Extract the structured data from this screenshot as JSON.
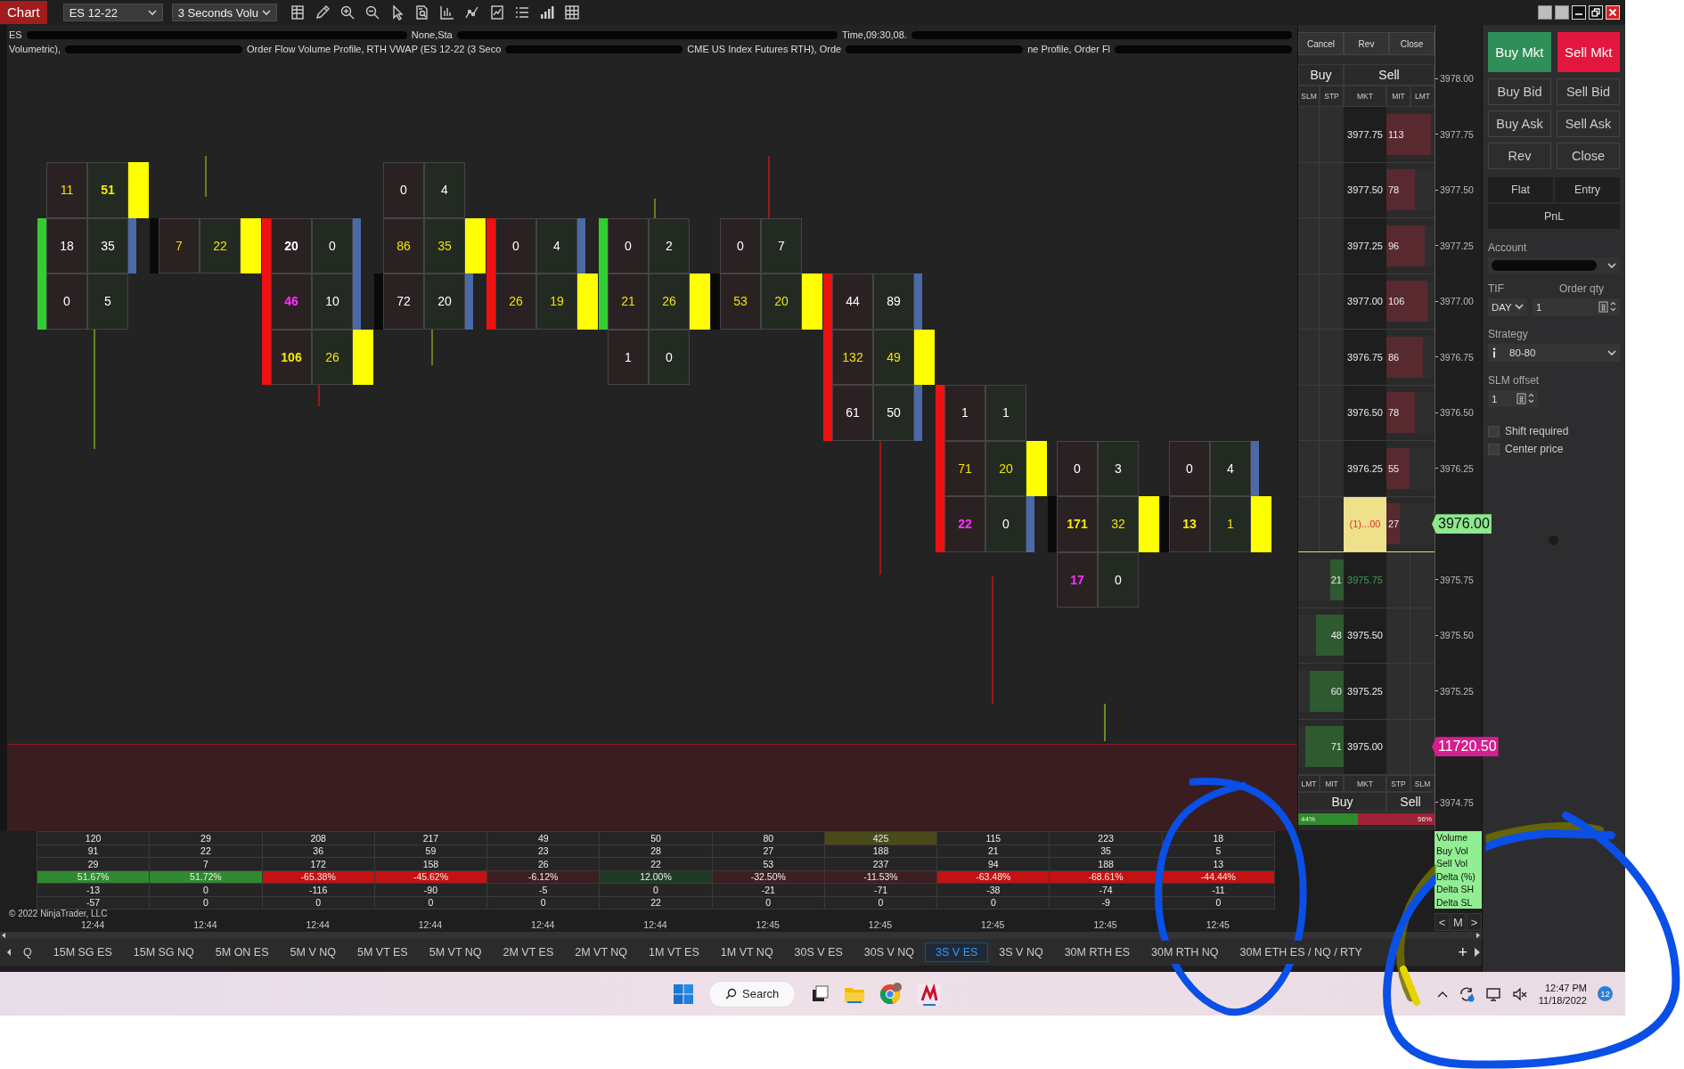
{
  "titlebar": {
    "app_label": "Chart",
    "instrument": "ES 12-22",
    "bar_type": "3 Seconds Volu"
  },
  "chart": {
    "header_lines": [
      [
        {
          "kind": "text",
          "text": "ES"
        },
        {
          "kind": "redacted"
        },
        {
          "kind": "text",
          "text": "None,Sta"
        },
        {
          "kind": "redacted"
        },
        {
          "kind": "text",
          "text": "Time,09:30,08."
        },
        {
          "kind": "redacted"
        }
      ],
      [
        {
          "kind": "text",
          "text": "Volumetric),"
        },
        {
          "kind": "redacted"
        },
        {
          "kind": "text",
          "text": "Order Flow Volume Profile, RTH VWAP (ES 12-22 (3 Seco"
        },
        {
          "kind": "redacted"
        },
        {
          "kind": "text",
          "text": "CME US Index Futures RTH), Orde"
        },
        {
          "kind": "redacted"
        },
        {
          "kind": "text",
          "text": "ne Profile, Order Fl"
        },
        {
          "kind": "redacted"
        }
      ]
    ],
    "bars": [
      {
        "levels": [
          {
            "kind": "cell",
            "bid": {
              "value": "11",
              "kind": "imbalance"
            },
            "ask": {
              "value": "51",
              "kind": "max"
            },
            "poc": true,
            "volume_marker": false
          },
          {
            "kind": "cell",
            "bid": {
              "value": "18",
              "kind": "plain"
            },
            "ask": {
              "value": "35",
              "kind": "plain"
            },
            "color": "#33cc33",
            "poc": false,
            "volume_marker": true
          },
          {
            "kind": "cell",
            "bid": {
              "value": "0",
              "kind": "plain"
            },
            "ask": {
              "value": "5",
              "kind": "plain"
            },
            "color": "#33cc33",
            "poc": false,
            "volume_marker": false
          },
          {
            "kind": "blank"
          },
          {
            "kind": "blank"
          },
          {
            "kind": "blank"
          },
          {
            "kind": "blank"
          },
          {
            "kind": "blank"
          }
        ]
      },
      {
        "levels": [
          {
            "kind": "blank"
          },
          {
            "kind": "cell",
            "bid": {
              "value": "7",
              "kind": "imbalance"
            },
            "ask": {
              "value": "22",
              "kind": "imbalance"
            },
            "color": "#0a0a0a",
            "poc": true,
            "volume_marker": false
          },
          {
            "kind": "blank"
          },
          {
            "kind": "blank"
          },
          {
            "kind": "blank"
          },
          {
            "kind": "blank"
          },
          {
            "kind": "blank"
          },
          {
            "kind": "blank"
          }
        ]
      },
      {
        "levels": [
          {
            "kind": "blank"
          },
          {
            "kind": "cell",
            "bid": {
              "value": "20",
              "kind": "bold"
            },
            "ask": {
              "value": "0",
              "kind": "plain"
            },
            "color": "#ee1111",
            "poc": false,
            "volume_marker": true
          },
          {
            "kind": "cell",
            "bid": {
              "value": "46",
              "kind": "strong"
            },
            "ask": {
              "value": "10",
              "kind": "plain"
            },
            "color": "#ee1111",
            "poc": false,
            "volume_marker": true
          },
          {
            "kind": "cell",
            "bid": {
              "value": "106",
              "kind": "max"
            },
            "ask": {
              "value": "26",
              "kind": "imbalance"
            },
            "color": "#ee1111",
            "poc": true,
            "volume_marker": false
          },
          {
            "kind": "blank"
          },
          {
            "kind": "blank"
          },
          {
            "kind": "blank"
          },
          {
            "kind": "blank"
          }
        ]
      },
      {
        "levels": [
          {
            "kind": "cell",
            "bid": {
              "value": "0",
              "kind": "plain"
            },
            "ask": {
              "value": "4",
              "kind": "plain"
            },
            "poc": false,
            "volume_marker": false
          },
          {
            "kind": "cell",
            "bid": {
              "value": "86",
              "kind": "imbalance"
            },
            "ask": {
              "value": "35",
              "kind": "imbalance"
            },
            "poc": true,
            "volume_marker": false
          },
          {
            "kind": "cell",
            "bid": {
              "value": "72",
              "kind": "plain"
            },
            "ask": {
              "value": "20",
              "kind": "plain"
            },
            "color": "#0a0a0a",
            "poc": false,
            "volume_marker": true
          },
          {
            "kind": "blank"
          },
          {
            "kind": "blank"
          },
          {
            "kind": "blank"
          },
          {
            "kind": "blank"
          },
          {
            "kind": "blank"
          }
        ]
      },
      {
        "levels": [
          {
            "kind": "blank"
          },
          {
            "kind": "cell",
            "bid": {
              "value": "0",
              "kind": "plain"
            },
            "ask": {
              "value": "4",
              "kind": "plain"
            },
            "color": "#ee1111",
            "poc": false,
            "volume_marker": true
          },
          {
            "kind": "cell",
            "bid": {
              "value": "26",
              "kind": "imbalance"
            },
            "ask": {
              "value": "19",
              "kind": "imbalance"
            },
            "color": "#ee1111",
            "poc": true,
            "volume_marker": false
          },
          {
            "kind": "blank"
          },
          {
            "kind": "blank"
          },
          {
            "kind": "blank"
          },
          {
            "kind": "blank"
          },
          {
            "kind": "blank"
          }
        ]
      },
      {
        "levels": [
          {
            "kind": "blank"
          },
          {
            "kind": "cell",
            "bid": {
              "value": "0",
              "kind": "plain"
            },
            "ask": {
              "value": "2",
              "kind": "plain"
            },
            "color": "#33cc33",
            "poc": false,
            "volume_marker": false
          },
          {
            "kind": "cell",
            "bid": {
              "value": "21",
              "kind": "imbalance"
            },
            "ask": {
              "value": "26",
              "kind": "imbalance"
            },
            "color": "#33cc33",
            "poc": true,
            "volume_marker": false
          },
          {
            "kind": "cell",
            "bid": {
              "value": "1",
              "kind": "plain"
            },
            "ask": {
              "value": "0",
              "kind": "plain"
            },
            "poc": false,
            "volume_marker": false
          },
          {
            "kind": "blank"
          },
          {
            "kind": "blank"
          },
          {
            "kind": "blank"
          },
          {
            "kind": "blank"
          }
        ]
      },
      {
        "levels": [
          {
            "kind": "blank"
          },
          {
            "kind": "cell",
            "bid": {
              "value": "0",
              "kind": "plain"
            },
            "ask": {
              "value": "7",
              "kind": "plain"
            },
            "poc": false,
            "volume_marker": false
          },
          {
            "kind": "cell",
            "bid": {
              "value": "53",
              "kind": "imbalance"
            },
            "ask": {
              "value": "20",
              "kind": "imbalance"
            },
            "color": "#0a0a0a",
            "poc": true,
            "volume_marker": false
          },
          {
            "kind": "blank"
          },
          {
            "kind": "blank"
          },
          {
            "kind": "blank"
          },
          {
            "kind": "blank"
          },
          {
            "kind": "blank"
          }
        ]
      },
      {
        "levels": [
          {
            "kind": "blank"
          },
          {
            "kind": "blank"
          },
          {
            "kind": "cell",
            "bid": {
              "value": "44",
              "kind": "plain"
            },
            "ask": {
              "value": "89",
              "kind": "plain"
            },
            "color": "#ee1111",
            "poc": false,
            "volume_marker": true
          },
          {
            "kind": "cell",
            "bid": {
              "value": "132",
              "kind": "imbalance"
            },
            "ask": {
              "value": "49",
              "kind": "imbalance"
            },
            "color": "#ee1111",
            "poc": true,
            "volume_marker": false
          },
          {
            "kind": "cell",
            "bid": {
              "value": "61",
              "kind": "plain"
            },
            "ask": {
              "value": "50",
              "kind": "plain"
            },
            "color": "#ee1111",
            "poc": false,
            "volume_marker": true
          },
          {
            "kind": "blank"
          },
          {
            "kind": "blank"
          },
          {
            "kind": "blank"
          }
        ]
      },
      {
        "levels": [
          {
            "kind": "blank"
          },
          {
            "kind": "blank"
          },
          {
            "kind": "blank"
          },
          {
            "kind": "blank"
          },
          {
            "kind": "cell",
            "bid": {
              "value": "1",
              "kind": "plain"
            },
            "ask": {
              "value": "1",
              "kind": "plain"
            },
            "color": "#ee1111",
            "poc": false,
            "volume_marker": false
          },
          {
            "kind": "cell",
            "bid": {
              "value": "71",
              "kind": "imbalance"
            },
            "ask": {
              "value": "20",
              "kind": "imbalance"
            },
            "color": "#ee1111",
            "poc": true,
            "volume_marker": false
          },
          {
            "kind": "cell",
            "bid": {
              "value": "22",
              "kind": "strong"
            },
            "ask": {
              "value": "0",
              "kind": "plain"
            },
            "color": "#ee1111",
            "poc": false,
            "volume_marker": true
          },
          {
            "kind": "blank"
          }
        ]
      },
      {
        "levels": [
          {
            "kind": "blank"
          },
          {
            "kind": "blank"
          },
          {
            "kind": "blank"
          },
          {
            "kind": "blank"
          },
          {
            "kind": "blank"
          },
          {
            "kind": "cell",
            "bid": {
              "value": "0",
              "kind": "plain"
            },
            "ask": {
              "value": "3",
              "kind": "plain"
            },
            "poc": false,
            "volume_marker": false
          },
          {
            "kind": "cell",
            "bid": {
              "value": "171",
              "kind": "max"
            },
            "ask": {
              "value": "32",
              "kind": "imbalance"
            },
            "color": "#0a0a0a",
            "poc": true,
            "volume_marker": false
          },
          {
            "kind": "cell",
            "bid": {
              "value": "17",
              "kind": "strong"
            },
            "ask": {
              "value": "0",
              "kind": "plain"
            },
            "poc": false,
            "volume_marker": false
          }
        ]
      },
      {
        "levels": [
          {
            "kind": "blank"
          },
          {
            "kind": "blank"
          },
          {
            "kind": "blank"
          },
          {
            "kind": "blank"
          },
          {
            "kind": "blank"
          },
          {
            "kind": "cell",
            "bid": {
              "value": "0",
              "kind": "plain"
            },
            "ask": {
              "value": "4",
              "kind": "plain"
            },
            "poc": false,
            "volume_marker": true
          },
          {
            "kind": "cell",
            "bid": {
              "value": "13",
              "kind": "max"
            },
            "ask": {
              "value": "1",
              "kind": "imbalance"
            },
            "color": "#0a0a0a",
            "poc": true,
            "volume_marker": false
          },
          {
            "kind": "blank"
          }
        ]
      }
    ]
  },
  "dom": {
    "header_actions": [
      "Cancel",
      "Rev",
      "Close"
    ],
    "top_sides": [
      "Buy",
      "Sell"
    ],
    "top_columns": [
      "SLM",
      "STP",
      "MKT",
      "MIT",
      "LMT"
    ],
    "rows": [
      {
        "price": "3977.75",
        "kind": "ask",
        "size": "113",
        "level": 0.92,
        "highlight": false,
        "uptick": false
      },
      {
        "price": "3977.50",
        "kind": "ask",
        "size": "78",
        "level": 0.6,
        "highlight": false,
        "uptick": false
      },
      {
        "price": "3977.25",
        "kind": "ask",
        "size": "96",
        "level": 0.8,
        "highlight": false,
        "uptick": false
      },
      {
        "price": "3977.00",
        "kind": "ask",
        "size": "106",
        "level": 0.86,
        "highlight": false,
        "uptick": false
      },
      {
        "price": "3976.75",
        "kind": "ask",
        "size": "86",
        "level": 0.75,
        "highlight": false,
        "uptick": false
      },
      {
        "price": "3976.50",
        "kind": "ask",
        "size": "78",
        "level": 0.6,
        "highlight": false,
        "uptick": false
      },
      {
        "price": "3976.25",
        "kind": "ask",
        "size": "55",
        "level": 0.48,
        "highlight": false,
        "uptick": false
      },
      {
        "price": "(1)...00",
        "kind": "ask",
        "size": "27",
        "level": 0.28,
        "highlight": true,
        "uptick": false
      },
      {
        "price": "3975.75",
        "kind": "bid",
        "size": "21",
        "level": 0.3,
        "highlight": false,
        "uptick": true
      },
      {
        "price": "3975.50",
        "kind": "bid",
        "size": "48",
        "level": 0.6,
        "highlight": false,
        "uptick": false
      },
      {
        "price": "3975.25",
        "kind": "bid",
        "size": "60",
        "level": 0.75,
        "highlight": false,
        "uptick": false
      },
      {
        "price": "3975.00",
        "kind": "bid",
        "size": "71",
        "level": 0.85,
        "highlight": false,
        "uptick": false
      }
    ],
    "bottom_columns": [
      "LMT",
      "MIT",
      "MKT",
      "STP",
      "SLM"
    ],
    "bottom_sides": [
      "Buy",
      "Sell"
    ],
    "balance": {
      "level": 0.44,
      "buy_label": "44%",
      "sell_label": "56%"
    }
  },
  "price_axis": [
    {
      "text": "3978.00",
      "kind": "tick"
    },
    {
      "text": "3977.75",
      "kind": "tick"
    },
    {
      "text": "3977.50",
      "kind": "tick"
    },
    {
      "text": "3977.25",
      "kind": "tick"
    },
    {
      "text": "3977.00",
      "kind": "tick"
    },
    {
      "text": "3976.75",
      "kind": "tick"
    },
    {
      "text": "3976.50",
      "kind": "tick"
    },
    {
      "text": "3976.25",
      "kind": "tick"
    },
    {
      "text": "3976.00",
      "kind": "last"
    },
    {
      "text": "3975.75",
      "kind": "tick"
    },
    {
      "text": "3975.50",
      "kind": "tick"
    },
    {
      "text": "3975.25",
      "kind": "tick"
    },
    {
      "text": "11720.50",
      "kind": "marker"
    },
    {
      "text": "3974.75",
      "kind": "tick"
    }
  ],
  "stats": {
    "rows": [
      {
        "label": "Volume",
        "cells": [
          {
            "value": "120",
            "highlight": false
          },
          {
            "value": "29",
            "highlight": false
          },
          {
            "value": "208",
            "highlight": false
          },
          {
            "value": "217",
            "highlight": false
          },
          {
            "value": "49",
            "highlight": false
          },
          {
            "value": "50",
            "highlight": false
          },
          {
            "value": "80",
            "highlight": false
          },
          {
            "value": "425",
            "highlight": true
          },
          {
            "value": "115",
            "highlight": false
          },
          {
            "value": "223",
            "highlight": false
          },
          {
            "value": "18",
            "highlight": false
          }
        ]
      },
      {
        "label": "Buy Vol",
        "cells": [
          {
            "value": "91"
          },
          {
            "value": "22"
          },
          {
            "value": "36"
          },
          {
            "value": "59"
          },
          {
            "value": "23"
          },
          {
            "value": "28"
          },
          {
            "value": "27"
          },
          {
            "value": "188"
          },
          {
            "value": "21"
          },
          {
            "value": "35"
          },
          {
            "value": "5"
          }
        ]
      },
      {
        "label": "Sell Vol",
        "cells": [
          {
            "value": "29"
          },
          {
            "value": "7"
          },
          {
            "value": "172"
          },
          {
            "value": "158"
          },
          {
            "value": "26"
          },
          {
            "value": "22"
          },
          {
            "value": "53"
          },
          {
            "value": "237"
          },
          {
            "value": "94"
          },
          {
            "value": "188"
          },
          {
            "value": "13"
          }
        ]
      },
      {
        "label": "Delta (%)",
        "cells": [
          {
            "value": "51.67%",
            "color": "#2f8a2f"
          },
          {
            "value": "51.72%",
            "color": "#2f8a2f"
          },
          {
            "value": "-65.38%",
            "color": "#c41111"
          },
          {
            "value": "-45.62%",
            "color": "#c41111"
          },
          {
            "value": "-6.12%",
            "color": "#3e1e22"
          },
          {
            "value": "12.00%",
            "color": "#1f3a24"
          },
          {
            "value": "-32.50%",
            "color": "#3e1e22"
          },
          {
            "value": "-11.53%",
            "color": "#3e1e22"
          },
          {
            "value": "-63.48%",
            "color": "#c41111"
          },
          {
            "value": "-68.61%",
            "color": "#c41111"
          },
          {
            "value": "-44.44%",
            "color": "#c41111"
          }
        ]
      },
      {
        "label": "Delta SH",
        "cells": [
          {
            "value": "-13"
          },
          {
            "value": "0"
          },
          {
            "value": "-116"
          },
          {
            "value": "-90"
          },
          {
            "value": "-5"
          },
          {
            "value": "0"
          },
          {
            "value": "-21"
          },
          {
            "value": "-71"
          },
          {
            "value": "-38"
          },
          {
            "value": "-74"
          },
          {
            "value": "-11"
          }
        ]
      },
      {
        "label": "Delta SL",
        "cells": [
          {
            "value": "-57"
          },
          {
            "value": "0"
          },
          {
            "value": "0"
          },
          {
            "value": "0"
          },
          {
            "value": "0"
          },
          {
            "value": "22"
          },
          {
            "value": "0"
          },
          {
            "value": "0"
          },
          {
            "value": "0"
          },
          {
            "value": "-9"
          },
          {
            "value": "0"
          }
        ]
      }
    ]
  },
  "copyright": "© 2022 NinjaTrader, LLC",
  "time_axis": [
    "12:44",
    "12:44",
    "12:44",
    "12:44",
    "12:44",
    "12:44",
    "12:45",
    "12:45",
    "12:45",
    "12:45",
    "12:45"
  ],
  "nav_buttons": [
    "<",
    "M",
    ">"
  ],
  "tabs": {
    "items": [
      {
        "label": "Q",
        "selected": false
      },
      {
        "label": "15M SG ES",
        "selected": false
      },
      {
        "label": "15M SG NQ",
        "selected": false
      },
      {
        "label": "5M ON ES",
        "selected": false
      },
      {
        "label": "5M V NQ",
        "selected": false
      },
      {
        "label": "5M VT ES",
        "selected": false
      },
      {
        "label": "5M VT NQ",
        "selected": false
      },
      {
        "label": "2M VT ES",
        "selected": false
      },
      {
        "label": "2M VT NQ",
        "selected": false
      },
      {
        "label": "1M VT ES",
        "selected": false
      },
      {
        "label": "1M VT NQ",
        "selected": false
      },
      {
        "label": "30S V ES",
        "selected": false
      },
      {
        "label": "30S V NQ",
        "selected": false
      },
      {
        "label": "3S V ES",
        "selected": true
      },
      {
        "label": "3S V NQ",
        "selected": false
      },
      {
        "label": "30M RTH ES",
        "selected": false
      },
      {
        "label": "30M RTH NQ",
        "selected": false
      },
      {
        "label": "30M ETH ES / NQ / RTY",
        "selected": false
      }
    ],
    "add": "+"
  },
  "order_panel": {
    "market_buttons": [
      {
        "label": "Buy Mkt",
        "kind": "buy"
      },
      {
        "label": "Sell Mkt",
        "kind": "sell"
      }
    ],
    "grid_buttons": [
      "Buy Bid",
      "Sell Bid",
      "Buy Ask",
      "Sell Ask",
      "Rev",
      "Close"
    ],
    "position_tabs": [
      "Flat",
      "Entry"
    ],
    "pnl": "PnL",
    "account_label": "Account",
    "tif_label": "TIF",
    "tif": "DAY",
    "qty_label": "Order qty",
    "qty": "1",
    "strategy_label": "Strategy",
    "strategy": "80-80",
    "slm_label": "SLM offset",
    "slm": "1",
    "checks": [
      {
        "label": "Shift required",
        "checked": false
      },
      {
        "label": "Center price",
        "checked": false
      }
    ]
  },
  "taskbar": {
    "search": "Search",
    "time": "12:47 PM",
    "date": "11/18/2022",
    "badge": "12"
  }
}
